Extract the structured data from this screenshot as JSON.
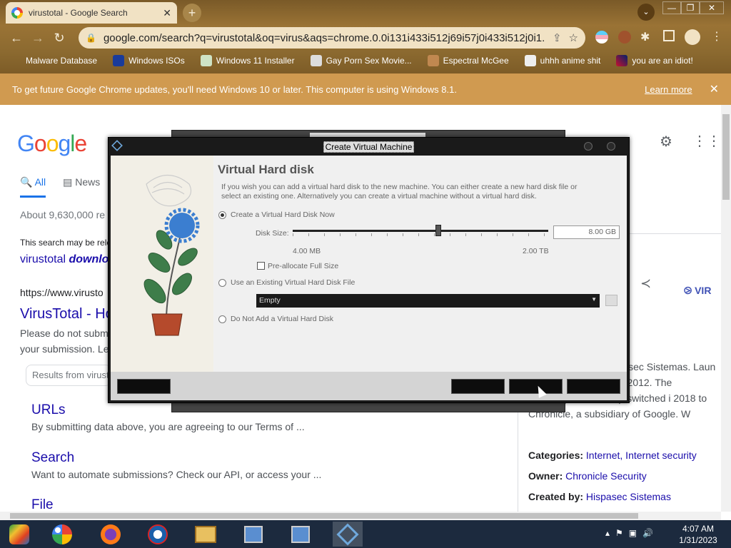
{
  "browser": {
    "tab_title": "virustotal - Google Search",
    "tab_close": "✕",
    "new_tab": "+",
    "url": "google.com/search?q=virustotal&oq=virus&aqs=chrome.0.0i131i433i512j69i57j0i433i512j0i1...",
    "window_controls": [
      "—",
      "❐",
      "✕"
    ],
    "bookmarks": [
      {
        "label": "Malware Database",
        "icon": "folder-icon"
      },
      {
        "label": "Windows ISOs",
        "icon": "x-icon"
      },
      {
        "label": "Windows 11 Installer",
        "icon": "image-icon"
      },
      {
        "label": "Gay Porn Sex Movie...",
        "icon": "skull-icon"
      },
      {
        "label": "Espectral McGee",
        "icon": "avatar-icon"
      },
      {
        "label": "uhhh anime shit",
        "icon": "anime-icon"
      },
      {
        "label": "you are an idiot!",
        "icon": "flag-icon"
      }
    ],
    "infobar_text": "To get future Google Chrome updates, you'll need Windows 10 or later. This computer is using Windows 8.1.",
    "infobar_link": "Learn more",
    "infobar_close": "✕"
  },
  "google": {
    "logo": [
      "G",
      "o",
      "o",
      "g",
      "l",
      "e"
    ],
    "tabs": [
      {
        "label": "All"
      },
      {
        "label": "News"
      }
    ],
    "about": "About 9,630,000 re",
    "notice": "This search may be rele",
    "download_link_a": "virustotal ",
    "download_link_b": "downlo",
    "result_url": "https://www.virusto",
    "result_title": "VirusTotal - Ho",
    "result_desc": "Please do not submi your submission. Le",
    "search_within": "Results from virust",
    "sitelinks": [
      {
        "title": "URLs",
        "desc": "By submitting data above, you are agreeing to our Terms of ..."
      },
      {
        "title": "Search",
        "desc": "Want to automate submissions? Check our API, or access your ..."
      },
      {
        "title": "File",
        "desc": ""
      }
    ],
    "kp_logo_text": "VIR",
    "kp_desc": "created by the Spani asec Sistemas. Laun ired by Google in Sep 2012. The company's ownership switched i 2018 to Chronicle, a subsidiary of Google. W",
    "kp_rows": [
      {
        "label": "Categories:",
        "value": "Internet, Internet security"
      },
      {
        "label": "Owner:",
        "value": "Chronicle Security"
      },
      {
        "label": "Created by:",
        "value": "Hispasec Sistemas"
      }
    ]
  },
  "dialog": {
    "title": "Create Virtual Machine",
    "heading": "Virtual Hard disk",
    "description": "If you wish you can add a virtual hard disk to the new machine. You can either create a new hard disk file or select an existing one. Alternatively you can create a virtual machine without a virtual hard disk.",
    "option_create": "Create a Virtual Hard Disk Now",
    "disk_size_label": "Disk Size:",
    "disk_size_value": "8.00 GB",
    "slider_min": "4.00 MB",
    "slider_max": "2.00 TB",
    "slider_fraction": 0.57,
    "preallocate": "Pre-allocate Full Size",
    "option_existing": "Use an Existing Virtual Hard Disk File",
    "existing_select": "Empty",
    "option_none": "Do Not Add a Virtual Hard Disk",
    "selected_option": "create"
  },
  "taskbar": {
    "apps": [
      "start-icon",
      "chrome-icon",
      "firefox-icon",
      "obama-icon",
      "explorer-icon",
      "network-app-icon",
      "network-app-icon",
      "virtualbox-icon"
    ],
    "time": "4:07 AM",
    "date": "1/31/2023"
  }
}
